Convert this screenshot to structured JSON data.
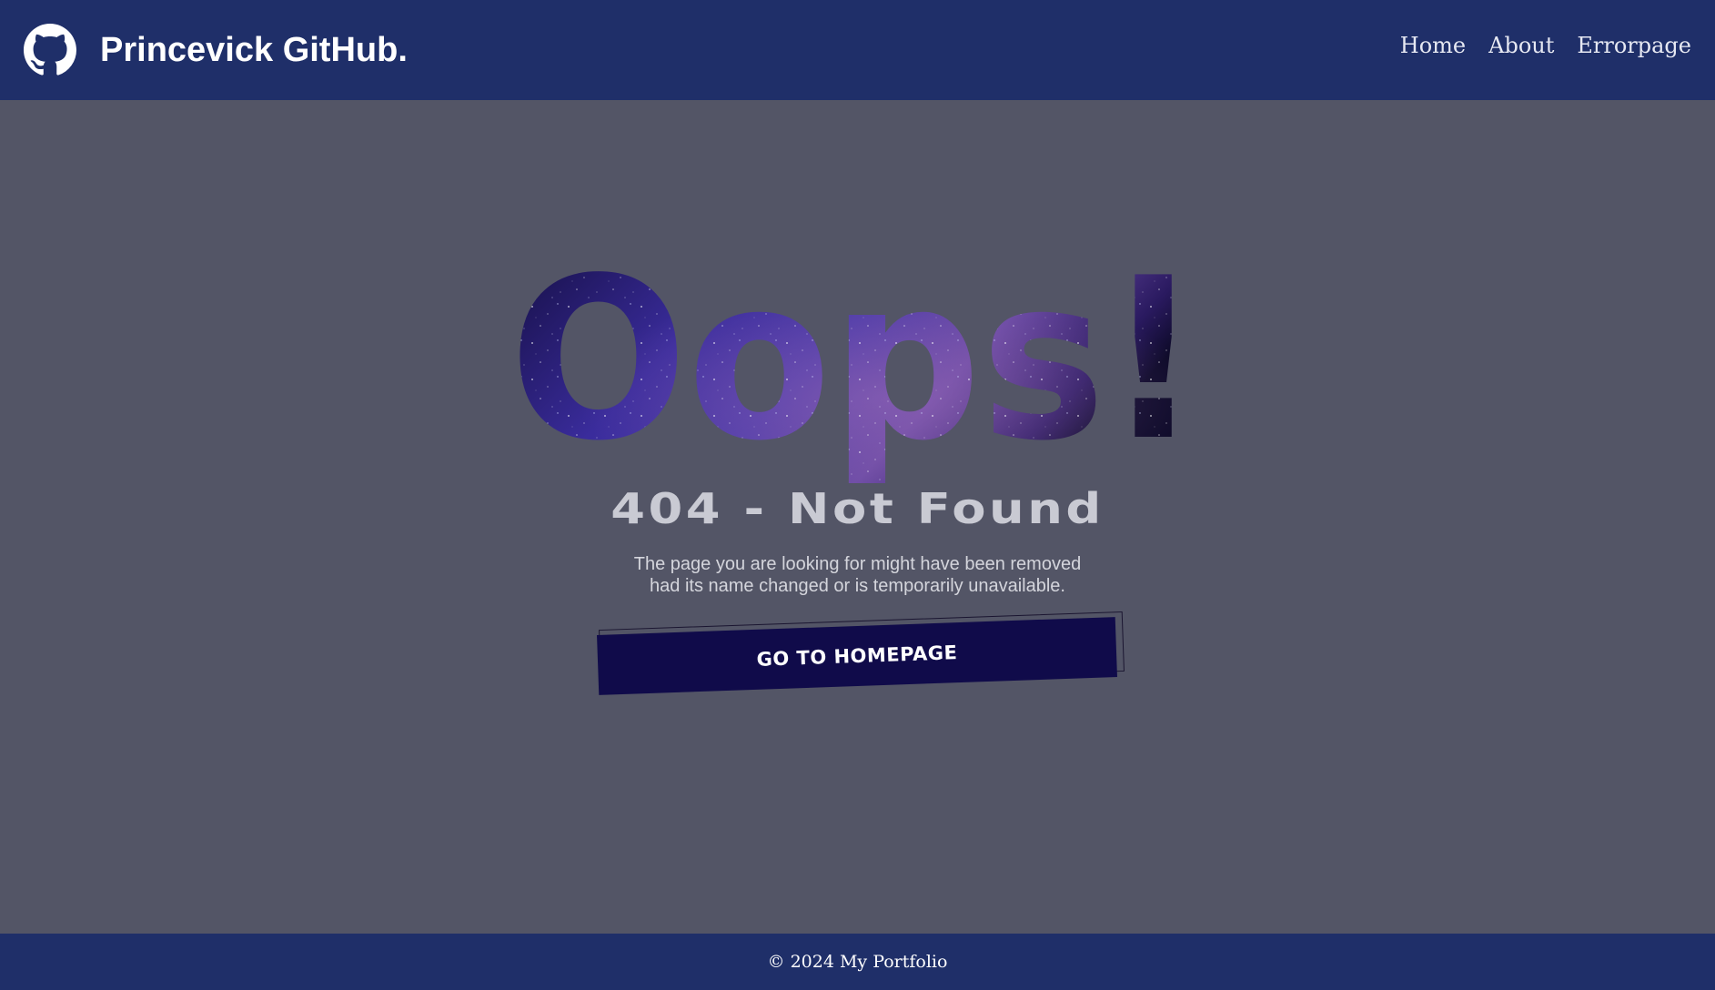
{
  "header": {
    "logo_icon": "github-octocat-icon",
    "title": "Princevick GitHub.",
    "nav": [
      {
        "label": "Home"
      },
      {
        "label": "About"
      },
      {
        "label": "Errorpage"
      }
    ]
  },
  "error": {
    "headline": "Oops!",
    "subtitle": "404 - Not Found",
    "description_line1": "The page you are looking for might have been removed",
    "description_line2": "had its name changed or is temporarily unavailable.",
    "cta_label": "GO TO HOMEPAGE"
  },
  "footer": {
    "text": "© 2024 My Portfolio"
  },
  "colors": {
    "header_bg": "#1f2f69",
    "page_bg": "#535566",
    "button_bg": "#100b4a",
    "headline_fill_dark": "#120c3d",
    "headline_fill_light": "#5a3aa0"
  }
}
